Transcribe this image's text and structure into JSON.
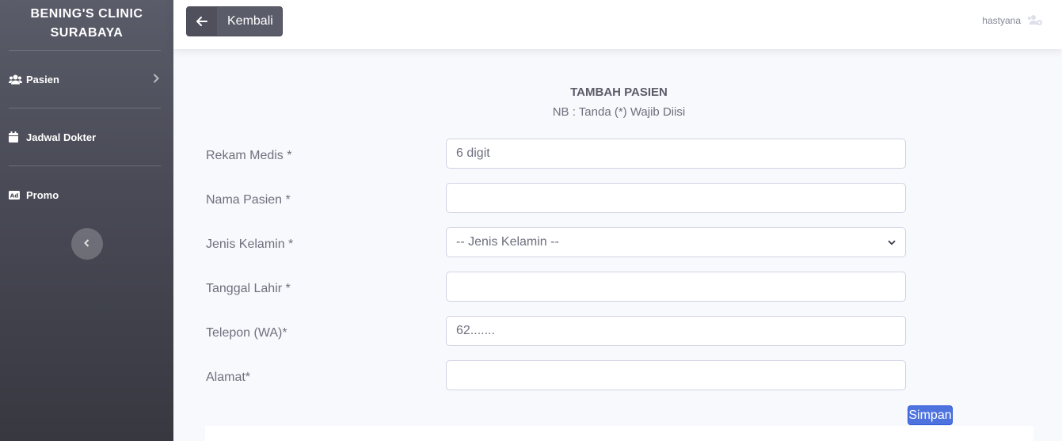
{
  "sidebar": {
    "brand_line1": "BENING'S CLINIC",
    "brand_line2": "SURABAYA",
    "items": [
      {
        "label": "Pasien",
        "icon": "users-icon",
        "has_chevron": true
      },
      {
        "label": "Jadwal Dokter",
        "icon": "calendar-icon"
      },
      {
        "label": "Promo",
        "icon": "ad-icon"
      }
    ],
    "toggle_icon": "chevron-left-icon"
  },
  "topbar": {
    "back_label": "Kembali",
    "back_icon": "arrow-left-icon",
    "username": "hastyana",
    "user_icon": "users-cog-icon"
  },
  "form": {
    "title": "TAMBAH PASIEN",
    "note": "NB : Tanda (*) Wajib Diisi",
    "fields": [
      {
        "label": "Rekam Medis *",
        "placeholder": "6 digit",
        "value": ""
      },
      {
        "label": "Nama Pasien *",
        "placeholder": "",
        "value": ""
      },
      {
        "label": "Jenis Kelamin *",
        "selected": "-- Jenis Kelamin --"
      },
      {
        "label": "Tanggal Lahir *",
        "placeholder": "",
        "value": ""
      },
      {
        "label": "Telepon (WA)*",
        "placeholder": "62.......",
        "value": ""
      },
      {
        "label": "Alamat*",
        "placeholder": "",
        "value": ""
      }
    ],
    "submit_label": "Simpan"
  },
  "colors": {
    "sidebar_top": "#5a5c69",
    "sidebar_bottom": "#373840",
    "primary": "#4e73df",
    "text_muted": "#6e707e"
  }
}
